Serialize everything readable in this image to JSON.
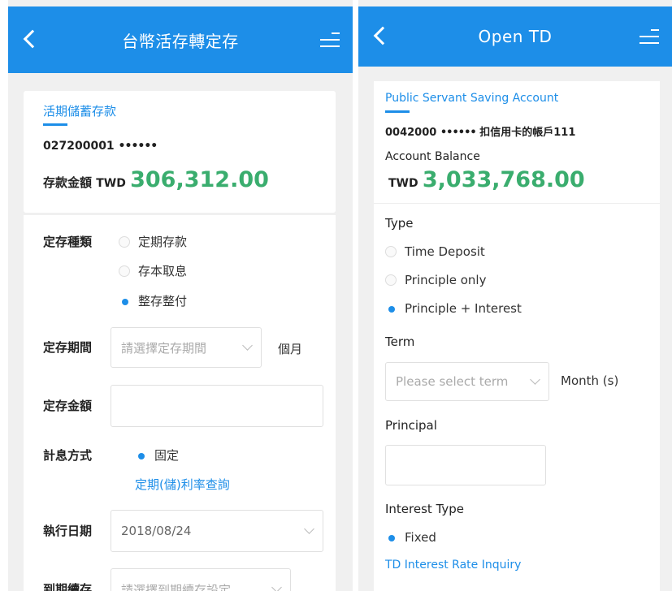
{
  "left": {
    "header": {
      "title": "台幣活存轉定存"
    },
    "account": {
      "name": "活期儲蓄存款",
      "number": "027200001",
      "masked": "••••••",
      "balance_label": "存款金額",
      "currency": "TWD",
      "amount": "306,312.00"
    },
    "form": {
      "type_label": "定存種類",
      "type_options": [
        "定期存款",
        "存本取息",
        "整存整付"
      ],
      "type_selected_index": 2,
      "term_label": "定存期間",
      "term_placeholder": "請選擇定存期間",
      "term_unit": "個月",
      "principal_label": "定存金額",
      "interest_label": "計息方式",
      "interest_option": "固定",
      "rate_link": "定期(儲)利率查詢",
      "date_label": "執行日期",
      "date_value": "2018/08/24",
      "renew_label": "到期續存",
      "renew_placeholder": "請選擇到期續存設定"
    }
  },
  "right": {
    "header": {
      "title": "Open TD"
    },
    "account": {
      "name": "Public Servant Saving Account",
      "number": "0042000",
      "masked": "••••••",
      "nickname": "扣信用卡的帳戶111",
      "balance_label": "Account Balance",
      "currency": "TWD",
      "amount": "3,033,768.00"
    },
    "form": {
      "type_label": "Type",
      "type_options": [
        "Time Deposit",
        "Principle only",
        "Principle + Interest"
      ],
      "type_selected_index": 2,
      "term_label": "Term",
      "term_placeholder": "Please select term",
      "term_unit": "Month (s)",
      "principal_label": "Principal",
      "interest_label": "Interest Type",
      "interest_option": "Fixed",
      "rate_link": "TD Interest Rate Inquiry"
    }
  },
  "colors": {
    "accent": "#1d8ee8",
    "amount_green": "#3aad6e",
    "background": "#f0f0f0"
  }
}
